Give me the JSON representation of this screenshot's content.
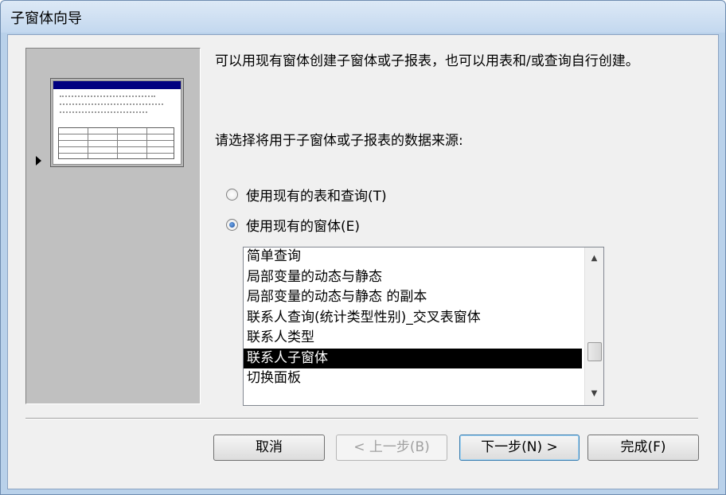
{
  "window": {
    "title": "子窗体向导"
  },
  "description": "可以用现有窗体创建子窗体或子报表，也可以用表和/或查询自行创建。",
  "prompt": "请选择将用于子窗体或子报表的数据来源:",
  "options": [
    {
      "label": "使用现有的表和查询(T)",
      "checked": false
    },
    {
      "label": "使用现有的窗体(E)",
      "checked": true
    }
  ],
  "form_list": {
    "items": [
      "简单查询",
      "局部变量的动态与静态",
      "局部变量的动态与静态 的副本",
      "联系人查询(统计类型性别)_交叉表窗体",
      "联系人类型",
      "联系人子窗体",
      "切换面板"
    ],
    "selected": "联系人子窗体",
    "scroll_up_icon": "▲",
    "scroll_down_icon": "▼"
  },
  "buttons": {
    "cancel": "取消",
    "back": "< 上一步(B)",
    "next": "下一步(N) >",
    "finish": "完成(F)"
  }
}
